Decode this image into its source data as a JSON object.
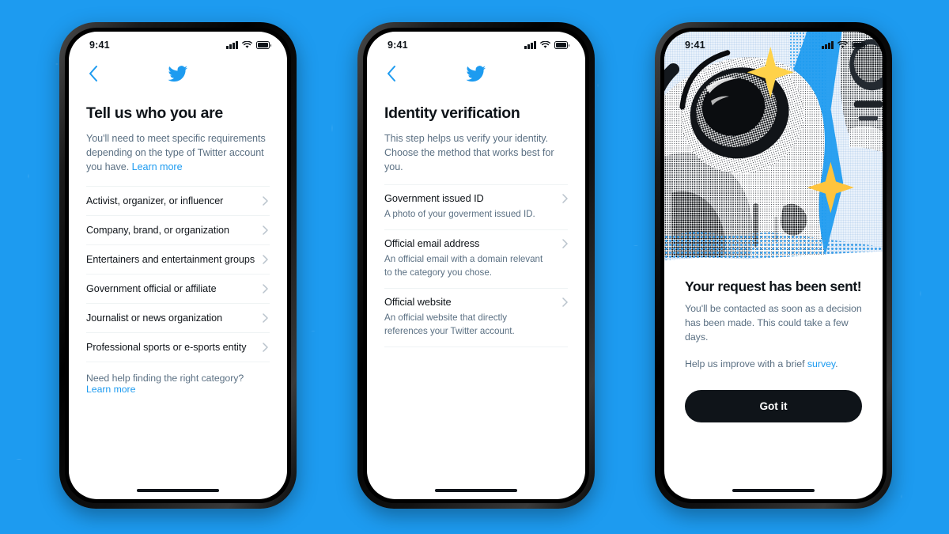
{
  "background": {
    "color": "#1D9BF0"
  },
  "theme": {
    "brand_blue": "#1D9BF0",
    "text_primary": "#0F1419",
    "text_secondary": "#5B7083",
    "divider": "#EFF3F4",
    "button_dark": "#0F1419"
  },
  "status_bar": {
    "time": "9:41"
  },
  "icons": {
    "back": "chevron-left-icon",
    "logo": "twitter-bird-icon",
    "row_chevron": "chevron-right-icon",
    "signal": "cellular-signal-icon",
    "wifi": "wifi-icon",
    "battery": "battery-full-icon"
  },
  "screens": [
    {
      "id": "tell-us-who-you-are",
      "title": "Tell us who you are",
      "description": "You'll need to meet specific requirements depending on the type of Twitter account you have.",
      "description_link": "Learn more",
      "categories": [
        {
          "label": "Activist, organizer, or influencer"
        },
        {
          "label": "Company, brand, or organization"
        },
        {
          "label": "Entertainers and entertainment groups"
        },
        {
          "label": "Government official or affiliate"
        },
        {
          "label": "Journalist or news organization"
        },
        {
          "label": "Professional sports or e-sports entity"
        }
      ],
      "help_text": "Need help finding the right category?",
      "help_link": "Learn more"
    },
    {
      "id": "identity-verification",
      "title": "Identity verification",
      "description": "This step helps us verify your identity. Choose the method that works best for you.",
      "methods": [
        {
          "title": "Government issued ID",
          "description": "A photo of your goverment issued ID."
        },
        {
          "title": "Official email address",
          "description": "An official email with a domain relevant to the category you chose."
        },
        {
          "title": "Official website",
          "description": "An official website that directly references your Twitter account."
        }
      ]
    },
    {
      "id": "request-sent",
      "illustration": "astronaut-halftone-collage",
      "title": "Your request has been sent!",
      "body": "You'll be contacted as soon as a decision has been made. This could take a few days.",
      "body2_prefix": "Help us improve with a brief ",
      "body2_link": "survey",
      "body2_suffix": ".",
      "cta_label": "Got it"
    }
  ]
}
